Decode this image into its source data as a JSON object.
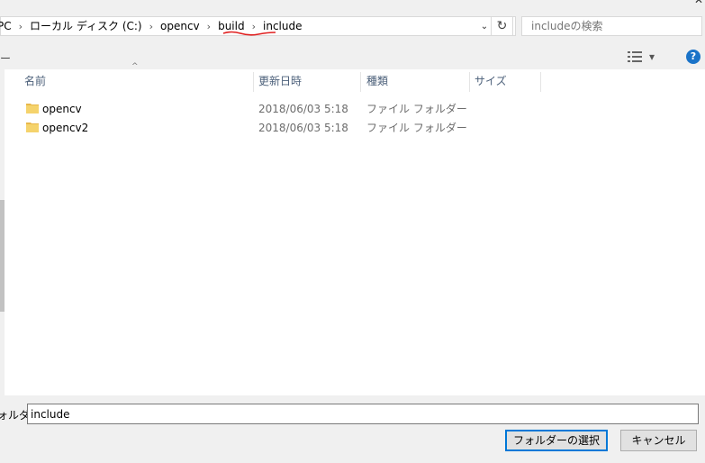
{
  "window": {
    "close_glyph": "✕"
  },
  "address_bar": {
    "crumbs": [
      "PC",
      "ローカル ディスク (C:)",
      "opencv",
      "build",
      "include"
    ],
    "separator": "›",
    "dropdown_glyph": "⌄",
    "annotation_color": "#e02020"
  },
  "refresh": {
    "glyph": "↻"
  },
  "search": {
    "placeholder": "includeの検索"
  },
  "toolbar": {
    "organize_fragment": "ー",
    "help_label": "?",
    "view_dropdown_glyph": "▾"
  },
  "columns": {
    "name": "名前",
    "date": "更新日時",
    "type": "種類",
    "size": "サイズ",
    "sort_glyph": "^"
  },
  "files": [
    {
      "name": "opencv",
      "date": "2018/06/03 5:18",
      "type": "ファイル フォルダー",
      "icon": "folder-icon"
    },
    {
      "name": "opencv2",
      "date": "2018/06/03 5:18",
      "type": "ファイル フォルダー",
      "icon": "folder-icon"
    }
  ],
  "folder_field": {
    "label": "ォルダー:",
    "value": "include"
  },
  "buttons": {
    "select": "フォルダーの選択",
    "cancel": "キャンセル"
  },
  "colors": {
    "folder": "#f5d36c",
    "help": "#1a73c8",
    "primary_border": "#0078d7"
  }
}
